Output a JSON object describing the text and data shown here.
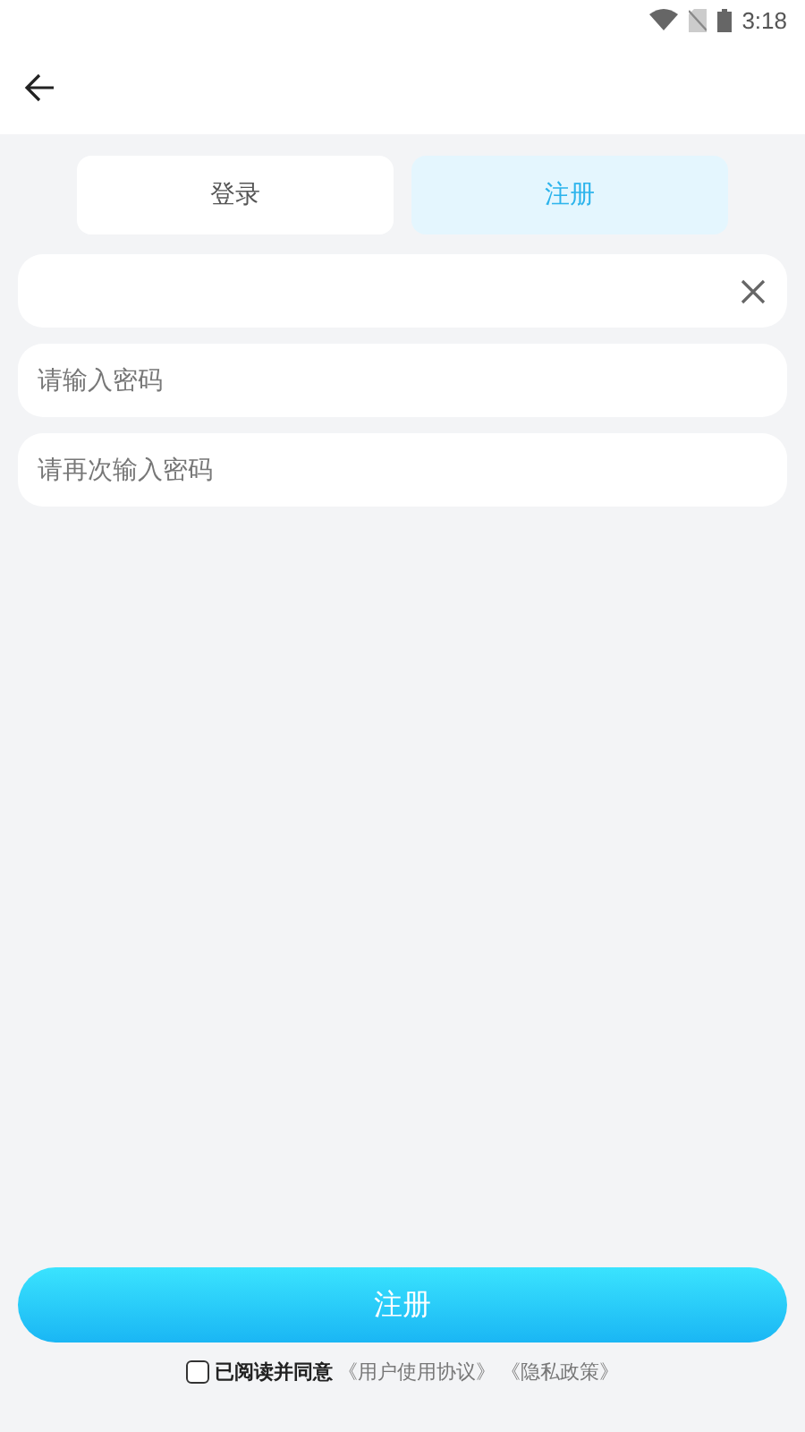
{
  "status_bar": {
    "time": "3:18"
  },
  "tabs": [
    {
      "label": "登录",
      "selected": false
    },
    {
      "label": "注册",
      "selected": true
    }
  ],
  "fields": [
    {
      "kind": "clearable"
    },
    {
      "kind": "plain",
      "placeholder": "请输入密码"
    },
    {
      "kind": "plain",
      "placeholder": "请再次输入密码"
    }
  ],
  "submit_button": "注册",
  "agreement": {
    "checked": false,
    "text": "已阅读并同意",
    "links": [
      "《用户使用协议》",
      "《隐私政策》"
    ]
  }
}
